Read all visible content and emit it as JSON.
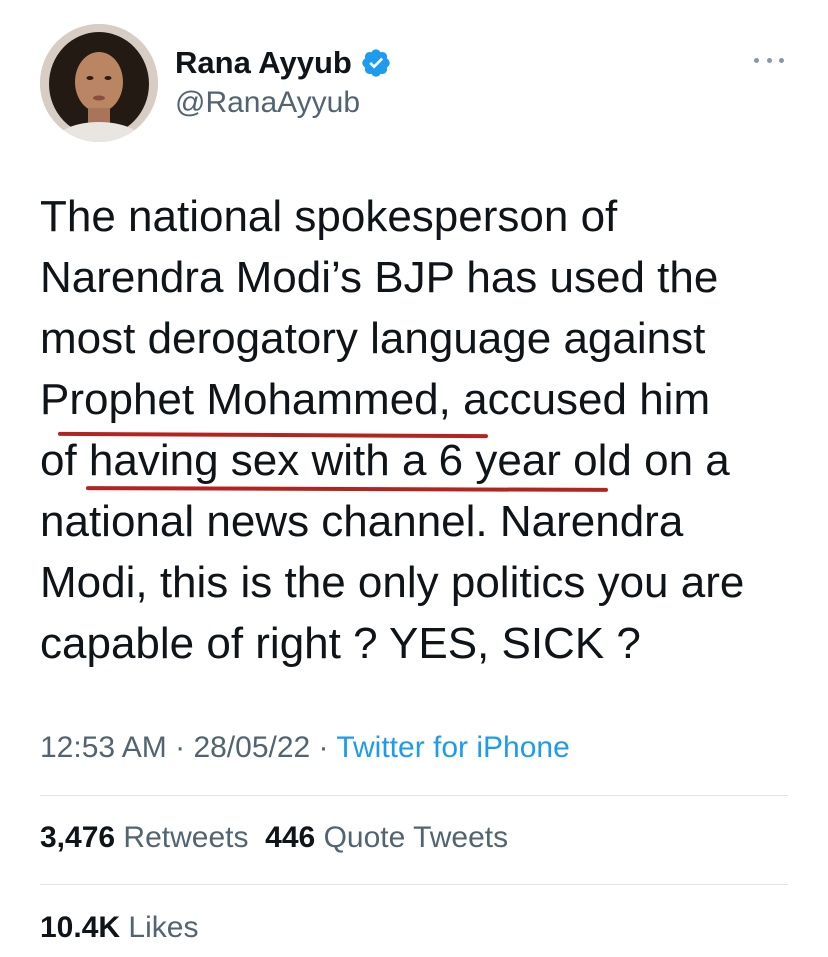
{
  "author": {
    "display_name": "Rana Ayyub",
    "handle": "@RanaAyyub",
    "verified": true
  },
  "tweet": {
    "lines": [
      "The national spokesperson of",
      "Narendra Modi’s BJP has used the",
      "most derogatory language against",
      "Prophet Mohammed, accused him",
      "of having sex with a 6 year old on a",
      "national news channel. Narendra",
      "Modi, this is the only politics you are",
      "capable of right ? YES, SICK ?"
    ]
  },
  "meta": {
    "time": "12:53 AM",
    "separator": " · ",
    "date": "28/05/22",
    "source": "Twitter for iPhone"
  },
  "stats": {
    "retweets_count": "3,476",
    "retweets_label": "Retweets",
    "quotes_count": "446",
    "quotes_label": "Quote Tweets",
    "likes_count": "10.4K",
    "likes_label": "Likes"
  },
  "colors": {
    "accent": "#1d9bf0",
    "secondary_text": "#536471",
    "annotation_underline": "#b5231f"
  }
}
